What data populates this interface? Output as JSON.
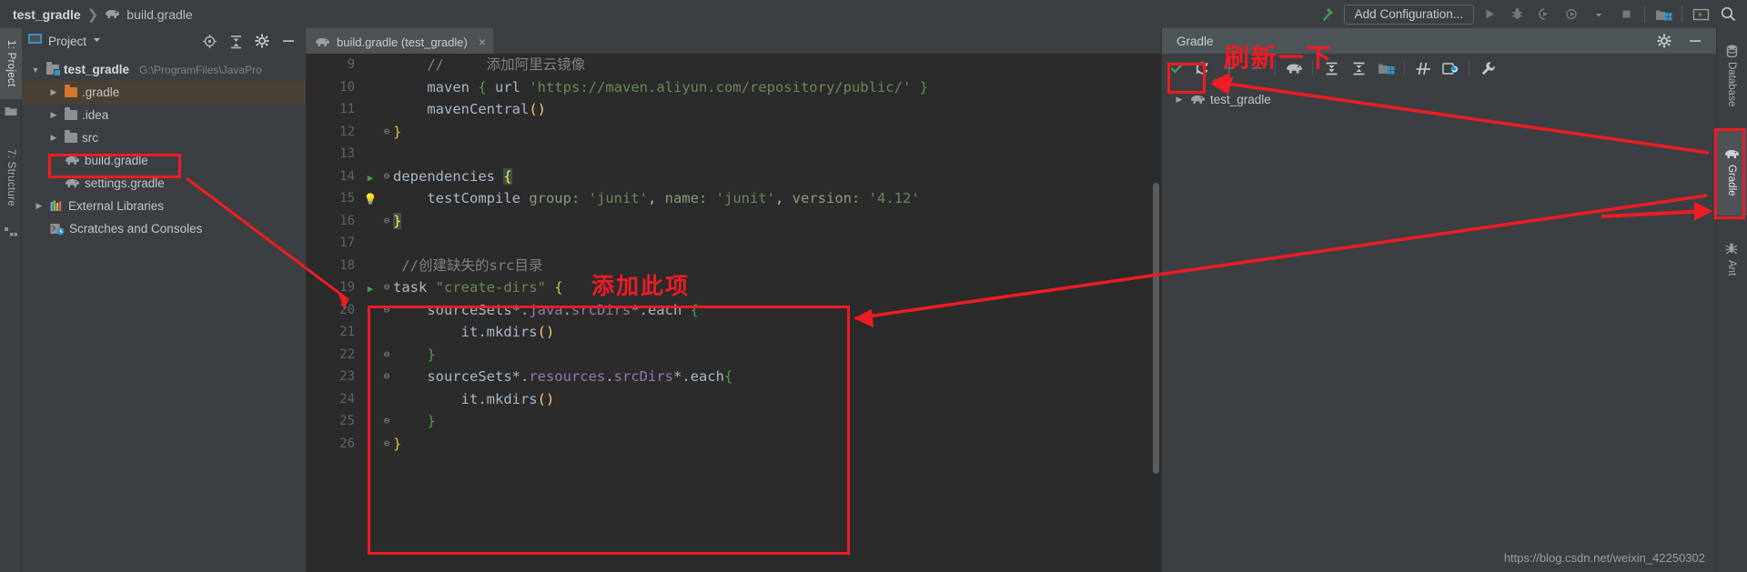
{
  "window": {
    "breadcrumb": {
      "project": "test_gradle",
      "separator": "❯",
      "file": "build.gradle"
    },
    "toolbar": {
      "add_configuration_label": "Add Configuration...",
      "icons": [
        "build-hammer-icon",
        "run-icon",
        "debug-icon",
        "run-coverage-icon",
        "profiler-icon",
        "dropdown-icon",
        "stop-icon",
        "project-structure-icon",
        "terminal-icon",
        "search-everywhere-icon"
      ]
    }
  },
  "left_strip": {
    "tabs": [
      {
        "label": "1: Project",
        "icon": "project-icon",
        "active": true
      },
      {
        "label": "7: Structure",
        "icon": "structure-icon",
        "active": false
      }
    ]
  },
  "project_panel": {
    "title": "Project",
    "dropdown_icon": "chevron-down-icon",
    "header_icons": [
      "locate-icon",
      "collapse-all-icon",
      "settings-gear-icon",
      "hide-icon"
    ],
    "tree": [
      {
        "label": "test_gradle",
        "path": "G:\\ProgramFiles\\JavaPro",
        "icon": "module-folder-icon",
        "depth": 0,
        "expanded": true,
        "bold": true,
        "selected": false
      },
      {
        "label": ".gradle",
        "icon": "excluded-folder-icon",
        "depth": 1,
        "expanded": false,
        "selected": true
      },
      {
        "label": ".idea",
        "icon": "folder-icon",
        "depth": 1,
        "expanded": false,
        "selected": false
      },
      {
        "label": "src",
        "icon": "folder-icon",
        "depth": 1,
        "expanded": false,
        "selected": false
      },
      {
        "label": "build.gradle",
        "icon": "gradle-elephant-icon",
        "depth": 1,
        "leaf": true,
        "selected": false
      },
      {
        "label": "settings.gradle",
        "icon": "gradle-elephant-icon",
        "depth": 1,
        "leaf": true,
        "selected": false
      },
      {
        "label": "External Libraries",
        "icon": "libraries-icon",
        "depth": 0,
        "expanded": false,
        "selected": false
      },
      {
        "label": "Scratches and Consoles",
        "icon": "scratches-icon",
        "depth": 0,
        "leaf": true,
        "selected": false
      }
    ]
  },
  "editor": {
    "tab": {
      "label": "build.gradle (test_gradle)",
      "icon": "gradle-elephant-icon",
      "close_icon": "close-icon"
    },
    "lines": [
      {
        "n": "9",
        "marker": "",
        "fold": "",
        "tokens": [
          {
            "t": "    ",
            "c": "plain"
          },
          {
            "t": "//     添加阿里云镜像",
            "c": "cmt"
          }
        ]
      },
      {
        "n": "10",
        "marker": "",
        "fold": "",
        "tokens": [
          {
            "t": "    maven ",
            "c": "plain"
          },
          {
            "t": "{",
            "c": "greenbr"
          },
          {
            "t": " url ",
            "c": "plain"
          },
          {
            "t": "'https://maven.aliyun.com/repository/public/'",
            "c": "str"
          },
          {
            "t": " ",
            "c": "plain"
          },
          {
            "t": "}",
            "c": "greenbr"
          }
        ]
      },
      {
        "n": "11",
        "marker": "",
        "fold": "",
        "tokens": [
          {
            "t": "    mavenCentral",
            "c": "plain"
          },
          {
            "t": "()",
            "c": "fn"
          }
        ]
      },
      {
        "n": "12",
        "marker": "",
        "fold": "⊖",
        "tokens": [
          {
            "t": "}",
            "c": "yellowbr"
          }
        ]
      },
      {
        "n": "13",
        "marker": "",
        "fold": "",
        "tokens": []
      },
      {
        "n": "14",
        "marker": "run",
        "fold": "⊖",
        "tokens": [
          {
            "t": "dependencies ",
            "c": "plain"
          },
          {
            "t": "{",
            "c": "hl-brace"
          }
        ]
      },
      {
        "n": "15",
        "marker": "bulb",
        "fold": "",
        "tokens": [
          {
            "t": "    testCompile ",
            "c": "plain"
          },
          {
            "t": "group:",
            "c": "param"
          },
          {
            "t": " ",
            "c": "plain"
          },
          {
            "t": "'junit'",
            "c": "str"
          },
          {
            "t": ", ",
            "c": "plain"
          },
          {
            "t": "name:",
            "c": "param"
          },
          {
            "t": " ",
            "c": "plain"
          },
          {
            "t": "'junit'",
            "c": "str"
          },
          {
            "t": ", ",
            "c": "plain"
          },
          {
            "t": "version:",
            "c": "param"
          },
          {
            "t": " ",
            "c": "plain"
          },
          {
            "t": "'4.12'",
            "c": "str"
          }
        ]
      },
      {
        "n": "16",
        "marker": "",
        "fold": "⊖",
        "tokens": [
          {
            "t": "}",
            "c": "hl-brace"
          }
        ]
      },
      {
        "n": "17",
        "marker": "",
        "fold": "",
        "tokens": []
      },
      {
        "n": "18",
        "marker": "",
        "fold": "",
        "tokens": [
          {
            "t": " //创建缺失的src目录",
            "c": "cmt"
          }
        ]
      },
      {
        "n": "19",
        "marker": "run",
        "fold": "⊖",
        "tokens": [
          {
            "t": "task ",
            "c": "plain"
          },
          {
            "t": "\"create-dirs\"",
            "c": "str"
          },
          {
            "t": " ",
            "c": "plain"
          },
          {
            "t": "{",
            "c": "yellowbr"
          }
        ]
      },
      {
        "n": "20",
        "marker": "",
        "fold": "⊖",
        "tokens": [
          {
            "t": "    sourceSets*.",
            "c": "plain"
          },
          {
            "t": "java",
            "c": "field"
          },
          {
            "t": ".",
            "c": "plain"
          },
          {
            "t": "srcDirs",
            "c": "field"
          },
          {
            "t": "*.each ",
            "c": "plain"
          },
          {
            "t": "{",
            "c": "greenbr"
          }
        ]
      },
      {
        "n": "21",
        "marker": "",
        "fold": "",
        "tokens": [
          {
            "t": "        it.mkdirs",
            "c": "plain"
          },
          {
            "t": "()",
            "c": "fn"
          }
        ]
      },
      {
        "n": "22",
        "marker": "",
        "fold": "⊖",
        "tokens": [
          {
            "t": "    }",
            "c": "greenbr"
          }
        ]
      },
      {
        "n": "23",
        "marker": "",
        "fold": "⊖",
        "tokens": [
          {
            "t": "    sourceSets*.",
            "c": "plain"
          },
          {
            "t": "resources",
            "c": "field"
          },
          {
            "t": ".",
            "c": "plain"
          },
          {
            "t": "srcDirs",
            "c": "field"
          },
          {
            "t": "*.each",
            "c": "plain"
          },
          {
            "t": "{",
            "c": "greenbr"
          }
        ]
      },
      {
        "n": "24",
        "marker": "",
        "fold": "",
        "tokens": [
          {
            "t": "        it.mkdirs",
            "c": "plain"
          },
          {
            "t": "()",
            "c": "fn"
          }
        ]
      },
      {
        "n": "25",
        "marker": "",
        "fold": "⊖",
        "tokens": [
          {
            "t": "    }",
            "c": "greenbr"
          }
        ]
      },
      {
        "n": "26",
        "marker": "",
        "fold": "⊖",
        "tokens": [
          {
            "t": "}",
            "c": "yellowbr"
          }
        ]
      }
    ]
  },
  "gradle_panel": {
    "tab_label": "Gradle",
    "header_icons": [
      "settings-gear-icon",
      "hide-icon"
    ],
    "status_icon": "checkmark-icon",
    "toolbar_icons": [
      "refresh-reload-gradle-project-icon",
      "add-gradle-project-icon",
      "remove-gradle-project-icon",
      "execute-gradle-task-icon",
      "expand-all-icon",
      "collapse-all-icon",
      "attach-gradle-project-icon",
      "toggle-offline-icon",
      "show-dependencies-icon",
      "gradle-settings-wrench-icon"
    ],
    "tree": [
      {
        "label": "test_gradle",
        "icon": "gradle-elephant-icon",
        "expanded": false
      }
    ]
  },
  "right_strip": {
    "tabs": [
      {
        "label": "Database",
        "icon": "database-icon",
        "active": false
      },
      {
        "label": "Gradle",
        "icon": "gradle-elephant-icon",
        "active": true
      },
      {
        "label": "Ant",
        "icon": "ant-icon",
        "active": false
      }
    ]
  },
  "annotations": {
    "refresh_note": "刷新一下",
    "add_item_note": "添加此项",
    "highlight_color": "#ee1c25"
  },
  "watermark": "https://blog.csdn.net/weixin_42250302"
}
